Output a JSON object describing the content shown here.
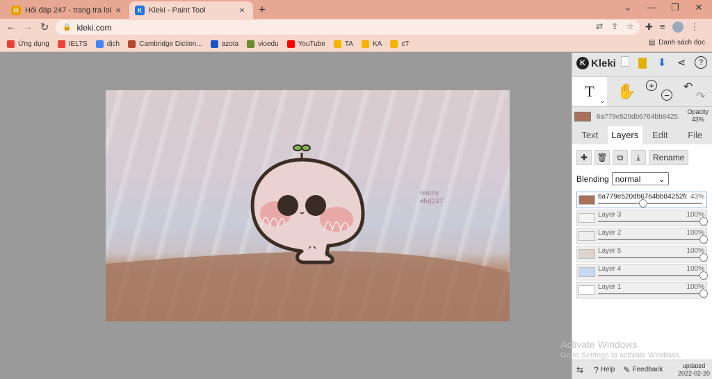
{
  "tabs": [
    {
      "title": "Hỏi đáp 247 - trang tra loi",
      "close": "×",
      "favicon_color": "#e8a000",
      "favicon_glyph": "H"
    },
    {
      "title": "Kleki - Paint Tool",
      "close": "×",
      "favicon_color": "#1a73e8",
      "favicon_glyph": "K"
    }
  ],
  "new_tab_label": "+",
  "window_controls": {
    "chevron": "⌄",
    "minimize": "—",
    "restore": "❐",
    "close": "✕"
  },
  "address": {
    "url": "kleki.com",
    "lock": "🔒"
  },
  "nav": {
    "back": "←",
    "forward": "→",
    "reload": "↻"
  },
  "bookmarks": [
    {
      "label": "Ứng dụng",
      "color": "#e94235"
    },
    {
      "label": "IELTS",
      "color": "#ea4335"
    },
    {
      "label": "dịch",
      "color": "#4285f4"
    },
    {
      "label": "Cambridge Diction...",
      "color": "#b54a2c"
    },
    {
      "label": "azota",
      "color": "#1a55c8"
    },
    {
      "label": "vioedu",
      "color": "#6a8b2f"
    },
    {
      "label": "YouTube",
      "color": "#ff0000"
    },
    {
      "label": "TA",
      "color": "#f4b400"
    },
    {
      "label": "KA",
      "color": "#f4b400"
    },
    {
      "label": "cT",
      "color": "#f4b400"
    }
  ],
  "bookmark_list_label": "Danh sách đọc",
  "canvas": {
    "watermark_line1": "reinny",
    "watermark_line2": "#hd247"
  },
  "panel": {
    "app_name": "Kleki",
    "text_tool_glyph": "T",
    "hand_glyph": "✋",
    "zoom_in": "+",
    "zoom_out": "−",
    "undo": "↶",
    "redo": "↷",
    "color_hex": "6a779e520db6764bb84252",
    "opacity_label": "Opacity",
    "opacity_value": "43%",
    "tabs": [
      "Text",
      "Layers",
      "Edit",
      "File"
    ],
    "active_tab": "Layers",
    "rename_label": "Rename",
    "blending_label": "Blending",
    "blending_value": "normal",
    "layers": [
      {
        "name": "6a779e520db6764bb84252fd",
        "opacity": "43%",
        "opacity_fraction": 0.43,
        "selected": true,
        "thumb": "#a8735a"
      },
      {
        "name": "Layer 3",
        "opacity": "100%",
        "opacity_fraction": 1.0,
        "selected": false,
        "thumb": "#f4f4f4"
      },
      {
        "name": "Layer 2",
        "opacity": "100%",
        "opacity_fraction": 1.0,
        "selected": false,
        "thumb": "#eeeeee"
      },
      {
        "name": "Layer 5",
        "opacity": "100%",
        "opacity_fraction": 1.0,
        "selected": false,
        "thumb": "#e0d4cf"
      },
      {
        "name": "Layer 4",
        "opacity": "100%",
        "opacity_fraction": 1.0,
        "selected": false,
        "thumb": "#c8d8f0"
      },
      {
        "name": "Layer 1",
        "opacity": "100%",
        "opacity_fraction": 1.0,
        "selected": false,
        "thumb": "#ffffff"
      }
    ],
    "footer": {
      "swap_icon": "⇆",
      "help_label": "Help",
      "feedback_label": "Feedback",
      "updated_label": "updated",
      "updated_date": "2022-02-20"
    }
  },
  "windows_notice": {
    "line1": "Activate Windows",
    "line2": "Go to Settings to activate Windows."
  }
}
